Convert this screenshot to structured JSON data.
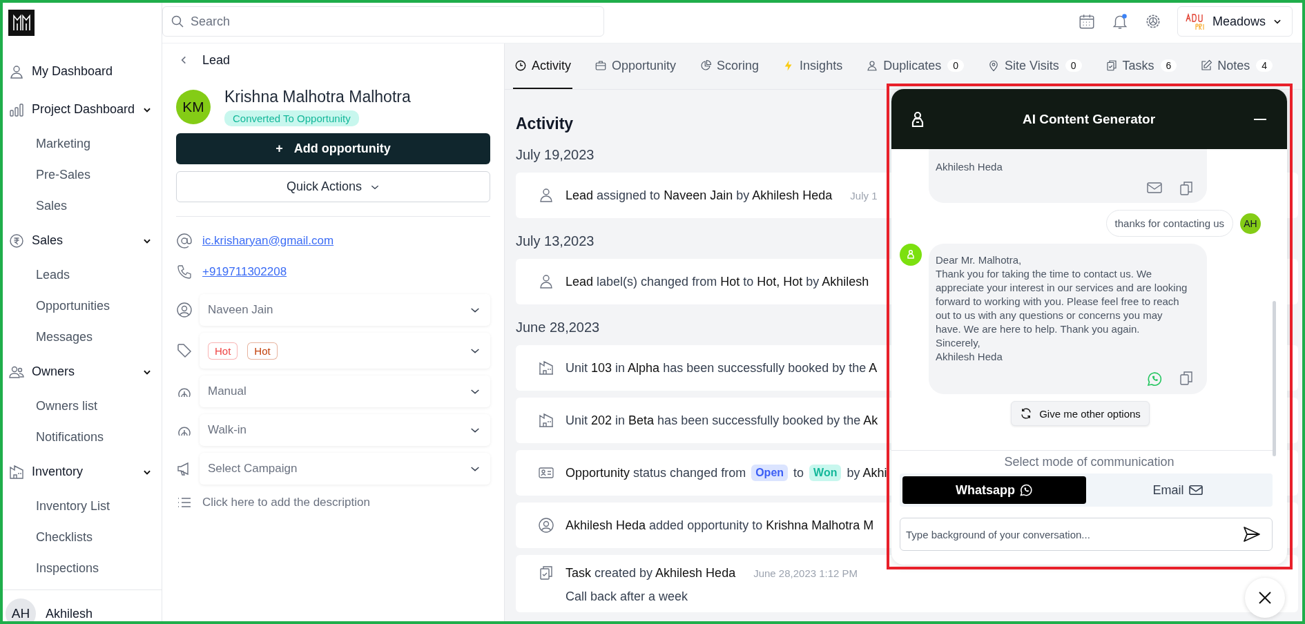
{
  "sidebar": {
    "items": [
      {
        "label": "My Dashboard"
      },
      {
        "label": "Project Dashboard",
        "expanded": true,
        "children": [
          "Marketing",
          "Pre-Sales",
          "Sales"
        ]
      },
      {
        "label": "Sales",
        "expanded": true,
        "children": [
          "Leads",
          "Opportunities",
          "Messages"
        ]
      },
      {
        "label": "Owners",
        "expanded": true,
        "children": [
          "Owners list",
          "Notifications"
        ]
      },
      {
        "label": "Inventory",
        "expanded": true,
        "children": [
          "Inventory List",
          "Checklists",
          "Inspections"
        ]
      }
    ],
    "user": {
      "initials": "AH",
      "name": "Akhilesh"
    }
  },
  "topbar": {
    "search": {
      "placeholder": "Search"
    },
    "notifications_unread": true,
    "project": "Meadows"
  },
  "lead": {
    "back_label": "Lead",
    "initials": "KM",
    "name": "Krishna Malhotra  Malhotra",
    "status": "Converted To Opportunity",
    "add_button": "Add opportunity",
    "add_icon": "+",
    "quick_actions": "Quick Actions",
    "email": "ic.krisharyan@gmail.com",
    "phone": "+919711302208",
    "owner": "Naveen Jain",
    "tags": [
      {
        "label": "Hot",
        "color": "#ef4444"
      },
      {
        "label": "Hot",
        "color": "#c2410c"
      }
    ],
    "source": "Manual",
    "sub_source": "Walk-in",
    "campaign": {
      "placeholder": "Select Campaign"
    },
    "description": {
      "placeholder": "Click here to add the description"
    }
  },
  "tabs": [
    {
      "label": "Activity",
      "selected": true
    },
    {
      "label": "Opportunity",
      "selected": false
    },
    {
      "label": "Scoring",
      "selected": false
    },
    {
      "label": "Insights",
      "selected": false
    },
    {
      "label": "Duplicates",
      "count": "0",
      "selected": false
    },
    {
      "label": "Site Visits",
      "count": "0",
      "selected": false
    },
    {
      "label": "Tasks",
      "count": "6",
      "selected": false
    },
    {
      "label": "Notes",
      "count": "4",
      "selected": false
    }
  ],
  "activity": {
    "title": "Activity",
    "groups": [
      {
        "date": "July 19,2023",
        "entries": [
          {
            "kind": "person",
            "text": "**Lead** assigned to **Naveen Jain** by **Akhilesh Heda**",
            "time": "July 1"
          }
        ]
      },
      {
        "date": "July 13,2023",
        "entries": [
          {
            "kind": "person",
            "text": "**Lead** label(s) changed from **Hot** to **Hot, Hot** by **Akhilesh**"
          }
        ]
      },
      {
        "date": "June 28,2023",
        "entries": [
          {
            "kind": "building",
            "text": "Unit **103** in **Alpha** has been successfully booked by the **A**"
          },
          {
            "kind": "building",
            "text": "Unit **202** in **Beta** has been successfully booked by the **Ak**"
          },
          {
            "kind": "status",
            "text": "**Opportunity** status changed from",
            "from": "Open",
            "middle": "to",
            "to": "Won",
            "after": "by **Akhi**"
          },
          {
            "kind": "user",
            "text": "**Akhilesh Heda** added opportunity to **Krishna Malhotra M**"
          },
          {
            "kind": "task",
            "text": "**Task** created by **Akhilesh Heda**",
            "time": "June 28,2023 1:12 PM",
            "note": "Call back after a week"
          }
        ]
      }
    ]
  },
  "ai_panel": {
    "title": "AI Content Generator",
    "messages": [
      {
        "kind": "bot",
        "text": "Akhilesh Heda",
        "sent_via_whatsapp": false
      },
      {
        "kind": "user",
        "text": "thanks for contacting us",
        "initials": "AH"
      },
      {
        "kind": "bot",
        "text": "Dear Mr. Malhotra,\nThank you for taking the time to contact us. We appreciate your interest in our services and are looking forward to working with you. Please feel free to reach out to us with any questions or concerns you may have. We are here to help. Thank you again.\nSincerely,\nAkhilesh Heda",
        "sent_via_whatsapp": true,
        "avatar": true
      }
    ],
    "regenerate": "Give me other options",
    "mode_label": "Select mode of communication",
    "modes": [
      {
        "label": "Whatsapp",
        "kind": "whatsapp",
        "selected": true
      },
      {
        "label": "Email",
        "kind": "email",
        "selected": false
      }
    ],
    "input": {
      "placeholder": "Type background of your conversation..."
    }
  }
}
